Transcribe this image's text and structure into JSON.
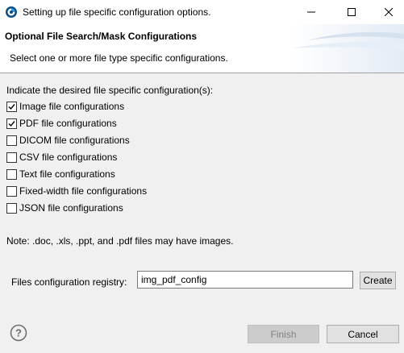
{
  "window": {
    "title": "Setting up file specific configuration options.",
    "icon": "app-logo-icon",
    "controls": [
      "minimize-icon",
      "maximize-icon",
      "close-icon"
    ]
  },
  "header": {
    "title": "Optional File Search/Mask Configurations",
    "description": "Select one or more file type specific configurations."
  },
  "body": {
    "prompt": "Indicate the desired file specific configuration(s):",
    "options": [
      {
        "label": "Image file configurations",
        "checked": true
      },
      {
        "label": "PDF file configurations",
        "checked": true
      },
      {
        "label": "DICOM file configurations",
        "checked": false
      },
      {
        "label": "CSV file configurations",
        "checked": false
      },
      {
        "label": "Text file configurations",
        "checked": false
      },
      {
        "label": "Fixed-width file configurations",
        "checked": false
      },
      {
        "label": "JSON file configurations",
        "checked": false
      }
    ],
    "note": "Note: .doc, .xls, .ppt, and .pdf files may have images."
  },
  "registry": {
    "label": "Files configuration registry:",
    "value": "img_pdf_config",
    "create_label": "Create"
  },
  "footer": {
    "help_icon": "help-icon",
    "finish_label": "Finish",
    "finish_enabled": false,
    "cancel_label": "Cancel"
  },
  "colors": {
    "dialog_bg": "#f0f0f0",
    "banner_bg": "#ffffff",
    "accent": "#1a5fb4"
  }
}
